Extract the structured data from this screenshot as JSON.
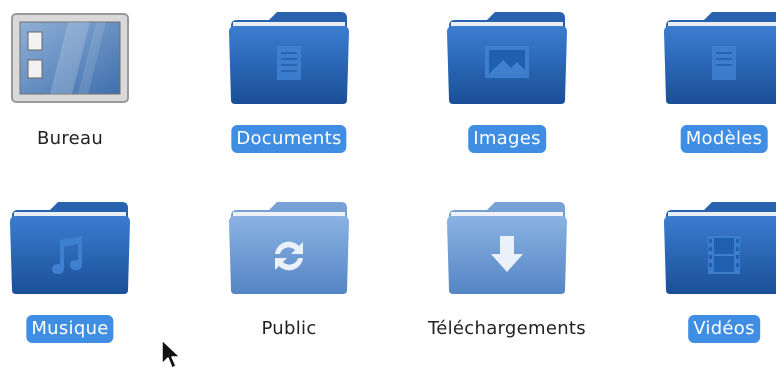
{
  "desktop_items": [
    {
      "label": "Bureau",
      "icon": "desktop-icon",
      "selected": false
    },
    {
      "label": "Documents",
      "icon": "folder-documents-icon",
      "selected": true
    },
    {
      "label": "Images",
      "icon": "folder-pictures-icon",
      "selected": true
    },
    {
      "label": "Modèles",
      "icon": "folder-templates-icon",
      "selected": true
    },
    {
      "label": "Musique",
      "icon": "folder-music-icon",
      "selected": true
    },
    {
      "label": "Public",
      "icon": "folder-publicshare-icon",
      "selected": false
    },
    {
      "label": "Téléchargements",
      "icon": "folder-download-icon",
      "selected": false
    },
    {
      "label": "Vidéos",
      "icon": "folder-videos-icon",
      "selected": true
    }
  ],
  "colors": {
    "folder_dark": "#1f5fb0",
    "folder_light": "#6f9fd6",
    "selection": "#3f8ee3"
  }
}
